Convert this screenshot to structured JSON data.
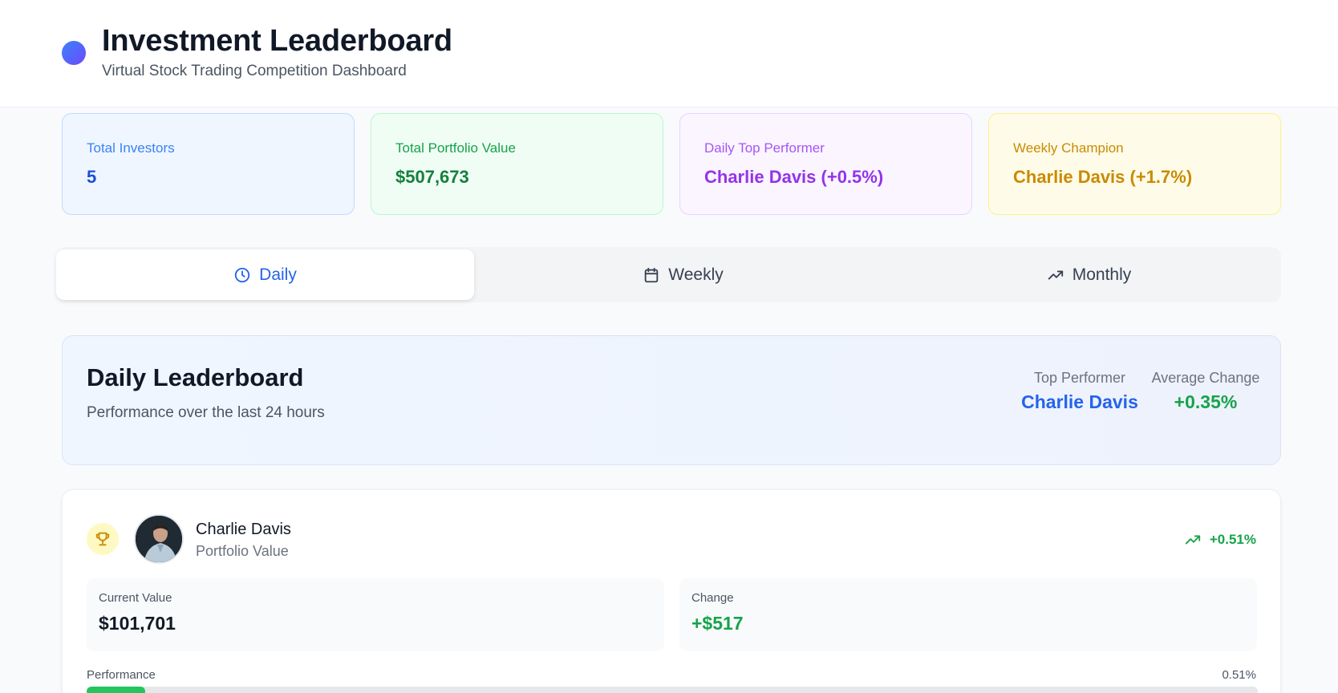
{
  "header": {
    "title": "Investment Leaderboard",
    "subtitle": "Virtual Stock Trading Competition Dashboard"
  },
  "stats": [
    {
      "label": "Total Investors",
      "value": "5"
    },
    {
      "label": "Total Portfolio Value",
      "value": "$507,673"
    },
    {
      "label": "Daily Top Performer",
      "value": "Charlie Davis (+0.5%)"
    },
    {
      "label": "Weekly Champion",
      "value": "Charlie Davis (+1.7%)"
    }
  ],
  "tabs": [
    {
      "label": "Daily",
      "icon": "clock-icon",
      "active": true
    },
    {
      "label": "Weekly",
      "icon": "calendar-icon",
      "active": false
    },
    {
      "label": "Monthly",
      "icon": "trending-up-icon",
      "active": false
    }
  ],
  "board": {
    "title": "Daily Leaderboard",
    "subtitle": "Performance over the last 24 hours",
    "top_performer_label": "Top Performer",
    "top_performer_value": "Charlie Davis",
    "avg_change_label": "Average Change",
    "avg_change_value": "+0.35%"
  },
  "entry": {
    "rank_icon": "trophy-icon",
    "name": "Charlie Davis",
    "subtitle": "Portfolio Value",
    "change_percent": "+0.51%",
    "current_value_label": "Current Value",
    "current_value": "$101,701",
    "change_label": "Change",
    "change_value": "+$517",
    "performance_label": "Performance",
    "performance_value": "0.51%",
    "performance_fill_percent": 5
  },
  "colors": {
    "accent": "#2563eb",
    "positive": "#16a34a",
    "purple": "#9333ea",
    "gold": "#ca8a04"
  }
}
